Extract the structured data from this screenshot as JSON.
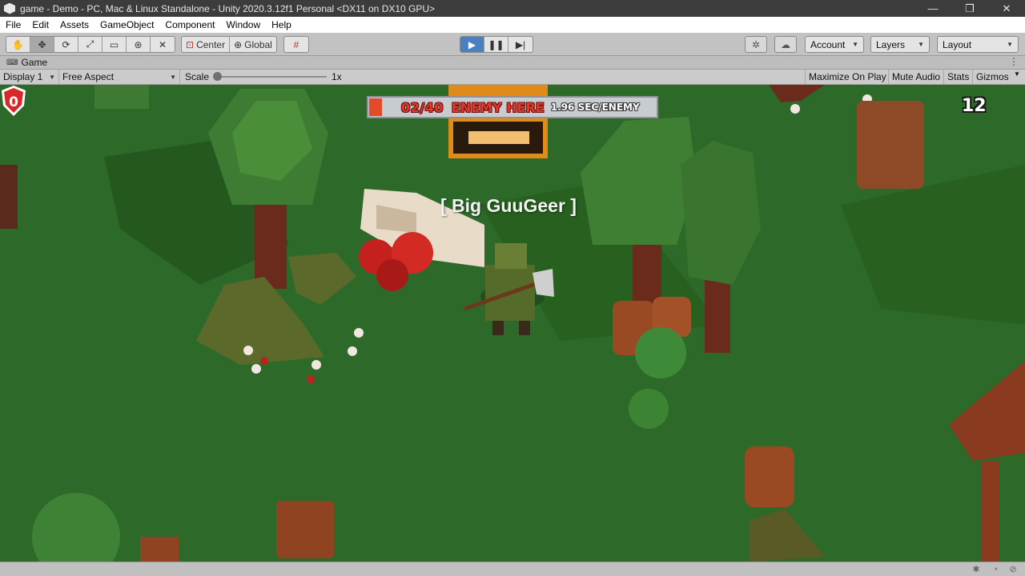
{
  "window": {
    "title": "game - Demo - PC, Mac & Linux Standalone - Unity 2020.3.12f1 Personal <DX11 on DX10 GPU>",
    "minimize": "—",
    "maximize": "❐",
    "close": "✕"
  },
  "menu": [
    "File",
    "Edit",
    "Assets",
    "GameObject",
    "Component",
    "Window",
    "Help"
  ],
  "toolbar": {
    "tools": [
      "hand-icon",
      "move-icon",
      "rotate-icon",
      "scale-icon",
      "rect-icon",
      "transform-icon",
      "custom-tool-icon"
    ],
    "pivot": "Center",
    "space": "Global",
    "snap_icon": "grid-snap-icon",
    "play_icon": "play-icon",
    "pause_icon": "pause-icon",
    "step_icon": "step-icon",
    "account": "Account",
    "layers": "Layers",
    "layout": "Layout"
  },
  "tab": {
    "label": "Game"
  },
  "game_controls": {
    "display": "Display 1",
    "aspect": "Free Aspect",
    "scale_label": "Scale",
    "scale_value": "1x",
    "maximize_on_play": "Maximize On Play",
    "mute_audio": "Mute Audio",
    "stats": "Stats",
    "gizmos": "Gizmos"
  },
  "hud": {
    "enemy_count": "02/40",
    "enemy_label": "ENEMY HERE",
    "spawn_rate": "1.96 SEC/ENEMY",
    "player_name": "[ Big GuuGeer ]",
    "shield_value": "0",
    "shield_count": "12"
  },
  "colors": {
    "grass": "#2d6a2a",
    "hud_red": "#e23a2a",
    "play_active": "#4a7fc0"
  }
}
